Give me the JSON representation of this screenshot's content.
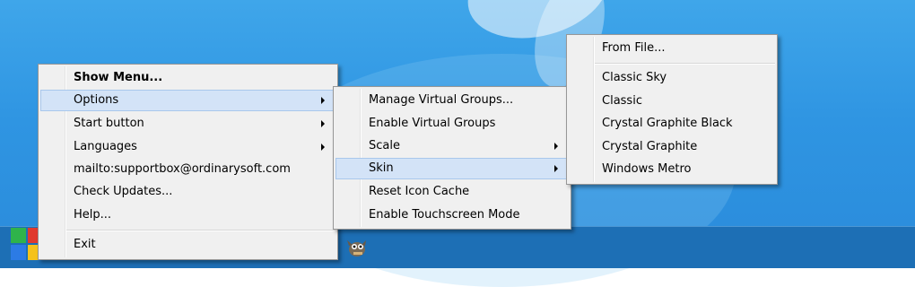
{
  "colors": {
    "menu_bg": "#f0f0f0",
    "menu_border": "#979797",
    "highlight": "#d3e3f7",
    "highlight_border": "#a8c7ec",
    "desktop": "#2f95e2",
    "taskbar": "#1d6fb5"
  },
  "main_menu": {
    "items": [
      {
        "label": "Show Menu..."
      },
      {
        "label": "Options"
      },
      {
        "label": "Start button"
      },
      {
        "label": "Languages"
      },
      {
        "label": "mailto:supportbox@ordinarysoft.com"
      },
      {
        "label": "Check Updates..."
      },
      {
        "label": "Help..."
      },
      {
        "label": "Exit"
      }
    ]
  },
  "options_menu": {
    "items": [
      {
        "label": "Manage Virtual Groups..."
      },
      {
        "label": "Enable Virtual Groups"
      },
      {
        "label": "Scale"
      },
      {
        "label": "Skin"
      },
      {
        "label": "Reset Icon Cache"
      },
      {
        "label": "Enable Touchscreen Mode"
      }
    ]
  },
  "skin_menu": {
    "items": [
      {
        "label": "From File..."
      },
      {
        "label": "Classic Sky"
      },
      {
        "label": "Classic"
      },
      {
        "label": "Crystal Graphite Black"
      },
      {
        "label": "Crystal Graphite"
      },
      {
        "label": "Windows Metro"
      }
    ]
  },
  "taskbar": {
    "icons": [
      "start-logo-icon",
      "gimp-icon"
    ]
  }
}
